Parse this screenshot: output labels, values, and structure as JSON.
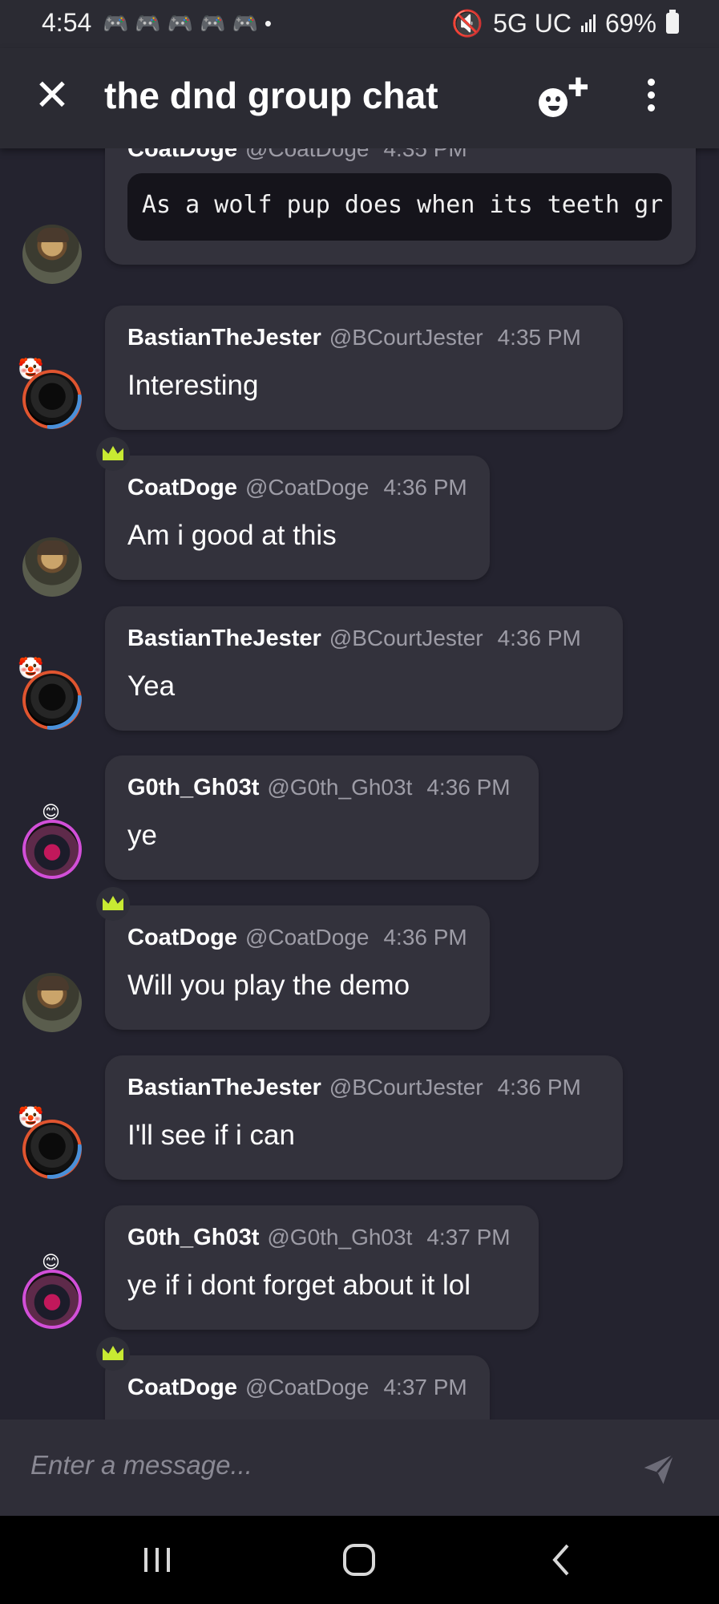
{
  "status": {
    "time": "4:54",
    "network": "5G UC",
    "battery": "69%"
  },
  "header": {
    "title": "the dnd group chat"
  },
  "messages": [
    {
      "name": "CoatDoge",
      "handle": "@CoatDoge",
      "time": "4:35 PM",
      "code": "As a wolf pup does when its teeth gr"
    },
    {
      "name": "BastianTheJester",
      "handle": "@BCourtJester",
      "time": "4:35 PM",
      "text": "Interesting"
    },
    {
      "name": "CoatDoge",
      "handle": "@CoatDoge",
      "time": "4:36 PM",
      "text": "Am i good at this"
    },
    {
      "name": "BastianTheJester",
      "handle": "@BCourtJester",
      "time": "4:36 PM",
      "text": "Yea"
    },
    {
      "name": "G0th_Gh03t",
      "handle": "@G0th_Gh03t",
      "time": "4:36 PM",
      "text": "ye"
    },
    {
      "name": "CoatDoge",
      "handle": "@CoatDoge",
      "time": "4:36 PM",
      "text": "Will you play the demo"
    },
    {
      "name": "BastianTheJester",
      "handle": "@BCourtJester",
      "time": "4:36 PM",
      "text": "I'll see if i can"
    },
    {
      "name": "G0th_Gh03t",
      "handle": "@G0th_Gh03t",
      "time": "4:37 PM",
      "text": "ye if i dont forget about it lol"
    },
    {
      "name": "CoatDoge",
      "handle": "@CoatDoge",
      "time": "4:37 PM"
    }
  ],
  "composer": {
    "placeholder": "Enter a message..."
  },
  "colors": {
    "background": "#24232f",
    "bubble": "#33323c",
    "crown": "#c8ea32",
    "muted_text": "#9d9ca6"
  }
}
